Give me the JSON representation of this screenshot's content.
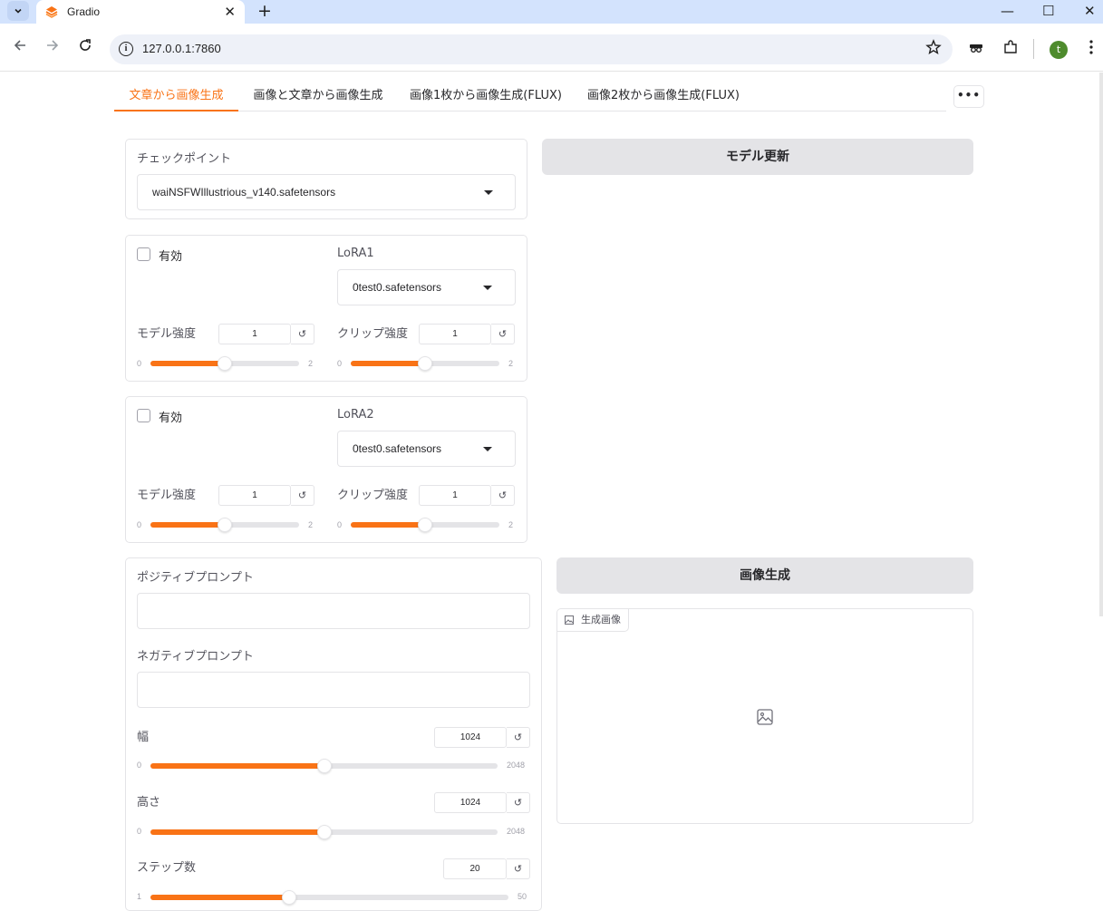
{
  "browser": {
    "tab_title": "Gradio",
    "tab_close": "✕",
    "new_tab": "+",
    "url": "127.0.0.1:7860",
    "profile_initial": "t",
    "window_controls": {
      "minimize": "—",
      "maximize": "☐",
      "close": "✕"
    },
    "icons": [
      "back-icon",
      "forward-icon",
      "reload-icon",
      "site-info-icon",
      "bookmark-star-icon",
      "incognito-icon",
      "extensions-icon",
      "menu-icon"
    ]
  },
  "tabs": [
    {
      "label": "文章から画像生成",
      "selected": true
    },
    {
      "label": "画像と文章から画像生成",
      "selected": false
    },
    {
      "label": "画像1枚から画像生成(FLUX)",
      "selected": false
    },
    {
      "label": "画像2枚から画像生成(FLUX)",
      "selected": false
    }
  ],
  "more_label": "•••",
  "checkpoint": {
    "label": "チェックポイント",
    "value": "waiNSFWIllustrious_v140.safetensors"
  },
  "update_model_button": "モデル更新",
  "lora": [
    {
      "enable_label": "有効",
      "enabled": false,
      "label": "LoRA1",
      "value": "0test0.safetensors",
      "model_strength": {
        "label": "モデル強度",
        "value": "1",
        "min": "0",
        "max": "2",
        "fraction": 0.5
      },
      "clip_strength": {
        "label": "クリップ強度",
        "value": "1",
        "min": "0",
        "max": "2",
        "fraction": 0.5
      }
    },
    {
      "enable_label": "有効",
      "enabled": false,
      "label": "LoRA2",
      "value": "0test0.safetensors",
      "model_strength": {
        "label": "モデル強度",
        "value": "1",
        "min": "0",
        "max": "2",
        "fraction": 0.5
      },
      "clip_strength": {
        "label": "クリップ強度",
        "value": "1",
        "min": "0",
        "max": "2",
        "fraction": 0.5
      }
    }
  ],
  "reset_symbol": "↺",
  "prompts": {
    "positive_label": "ポジティブプロンプト",
    "positive_value": "",
    "negative_label": "ネガティブプロンプト",
    "negative_value": ""
  },
  "width": {
    "label": "幅",
    "value": "1024",
    "min": "0",
    "max": "2048",
    "fraction": 0.5
  },
  "height": {
    "label": "高さ",
    "value": "1024",
    "min": "0",
    "max": "2048",
    "fraction": 0.5
  },
  "steps": {
    "label": "ステップ数",
    "value": "20",
    "min": "1",
    "max": "50",
    "fraction": 0.3878
  },
  "generate_button": "画像生成",
  "output_image": {
    "label": "生成画像",
    "icon": "image-icon"
  },
  "colors": {
    "accent": "#f97316",
    "track": "#e4e4e7",
    "button": "#e4e4e7",
    "browser_frame": "#d3e3fd"
  }
}
